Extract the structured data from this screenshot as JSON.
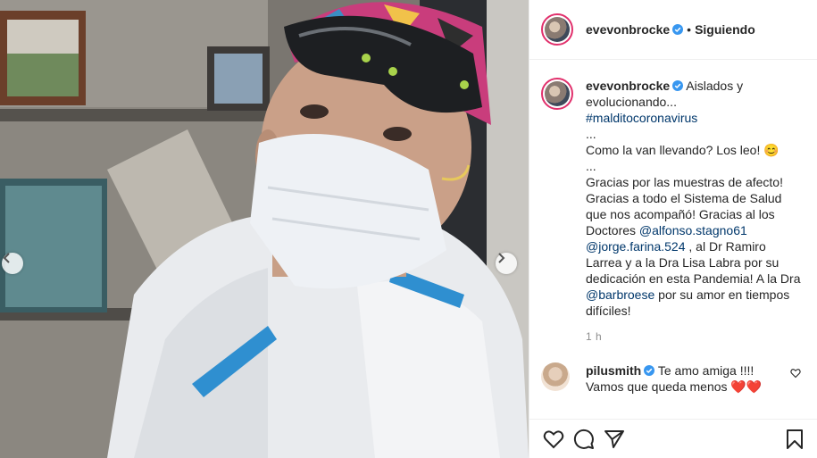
{
  "header": {
    "username": "evevonbrocke",
    "separator": "•",
    "follow_label": "Siguiendo"
  },
  "caption": {
    "username": "evevonbrocke",
    "line1": "Aislados y evolucionando...",
    "hashtag": "#malditocoronavirus",
    "sep1": "...",
    "line2": "Como la van llevando? Los leo! 😊",
    "sep2": "...",
    "line3a": "Gracias por las muestras de afecto! Gracias a todo el Sistema de Salud que nos acompañó! Gracias al los Doctores ",
    "mention1": "@alfonso.stagno61",
    "mention2": "@jorge.farina.524",
    "line3b": " , al Dr Ramiro Larrea y a la Dra Lisa Labra por su dedicación en esta Pandemia! A la Dra ",
    "mention3": "@barbroese",
    "line3c": " por su amor en tiempos difíciles!",
    "time": "1 h"
  },
  "comment": {
    "username": "pilusmith",
    "text": "Te amo amiga !!!! Vamos que queda menos ❤️❤️"
  },
  "icons": {
    "like": "heart-icon",
    "comment": "comment-bubble-icon",
    "share": "paper-plane-icon",
    "save": "bookmark-icon",
    "prev": "chevron-left-icon",
    "next": "chevron-right-icon",
    "verified": "verified-badge-icon"
  },
  "colors": {
    "verified": "#3897f0",
    "link": "#00376b",
    "avatar_ring": "#e1306c"
  }
}
